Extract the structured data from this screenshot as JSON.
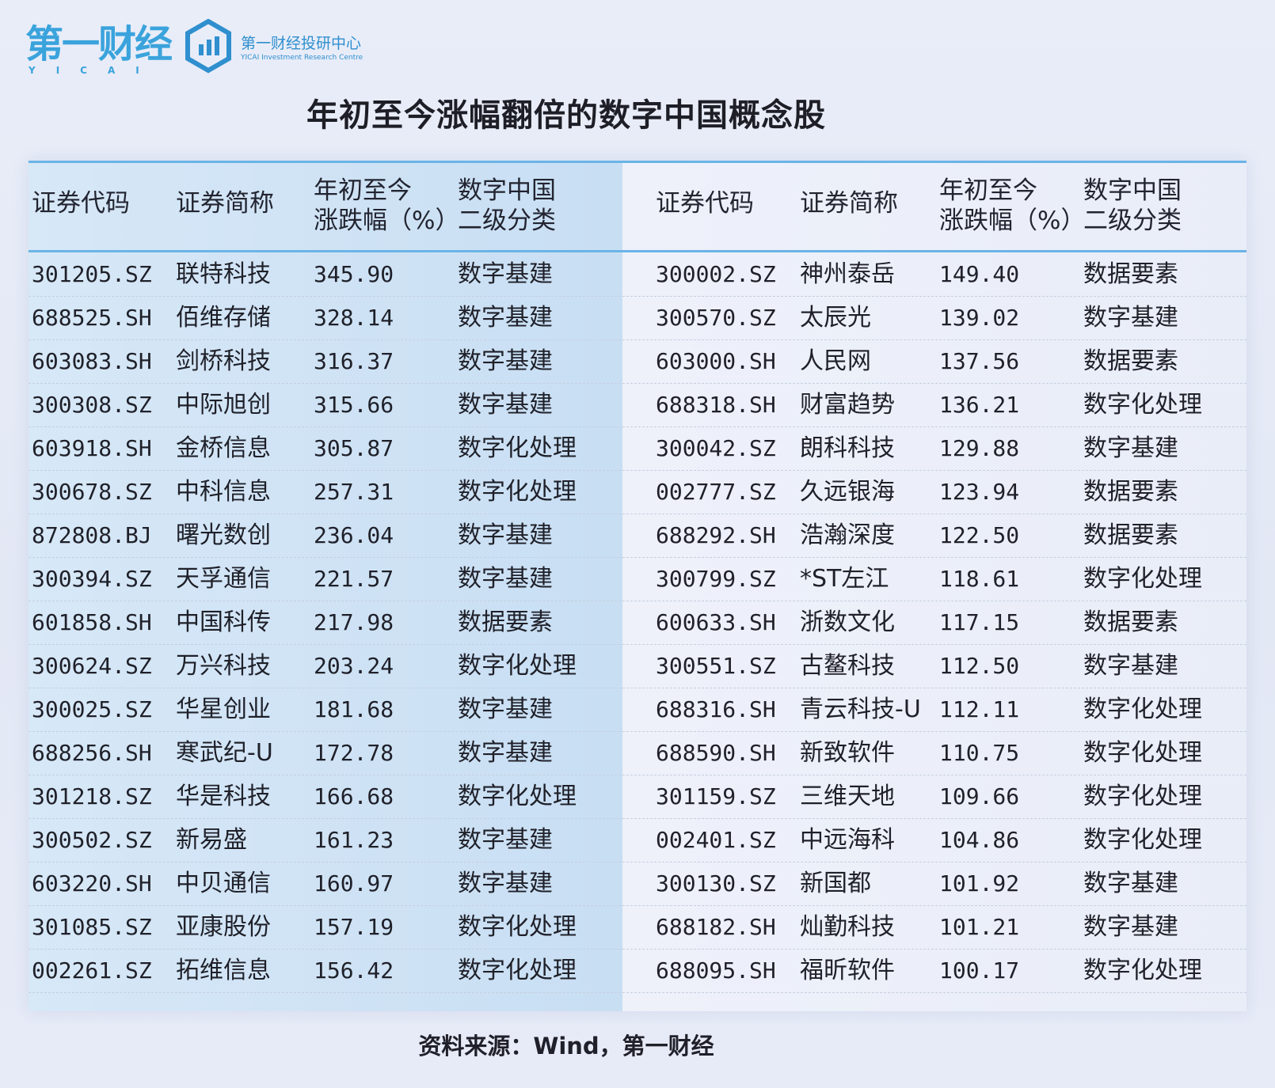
{
  "header": {
    "brand_wordmark": "第一财经",
    "brand_sub": "YICAI",
    "research_cn": "第一财经投研中心",
    "research_en": "YICAI Investment Research Centre",
    "logo_icon": "yicai-research-hexagon-icon",
    "accent_color": "#3aa3dc"
  },
  "title": "年初至今涨幅翻倍的数字中国概念股",
  "table": {
    "headers": {
      "code": "证券代码",
      "name": "证券简称",
      "change_line1": "年初至今",
      "change_line2": "涨跌幅（%）",
      "cat_line1": "数字中国",
      "cat_line2": "二级分类"
    },
    "left_rows": [
      {
        "code": "301205.SZ",
        "name": "联特科技",
        "change": "345.90",
        "category": "数字基建"
      },
      {
        "code": "688525.SH",
        "name": "佰维存储",
        "change": "328.14",
        "category": "数字基建"
      },
      {
        "code": "603083.SH",
        "name": "剑桥科技",
        "change": "316.37",
        "category": "数字基建"
      },
      {
        "code": "300308.SZ",
        "name": "中际旭创",
        "change": "315.66",
        "category": "数字基建"
      },
      {
        "code": "603918.SH",
        "name": "金桥信息",
        "change": "305.87",
        "category": "数字化处理"
      },
      {
        "code": "300678.SZ",
        "name": "中科信息",
        "change": "257.31",
        "category": "数字化处理"
      },
      {
        "code": "872808.BJ",
        "name": "曙光数创",
        "change": "236.04",
        "category": "数字基建"
      },
      {
        "code": "300394.SZ",
        "name": "天孚通信",
        "change": "221.57",
        "category": "数字基建"
      },
      {
        "code": "601858.SH",
        "name": "中国科传",
        "change": "217.98",
        "category": "数据要素"
      },
      {
        "code": "300624.SZ",
        "name": "万兴科技",
        "change": "203.24",
        "category": "数字化处理"
      },
      {
        "code": "300025.SZ",
        "name": "华星创业",
        "change": "181.68",
        "category": "数字基建"
      },
      {
        "code": "688256.SH",
        "name": "寒武纪-U",
        "change": "172.78",
        "category": "数字基建"
      },
      {
        "code": "301218.SZ",
        "name": "华是科技",
        "change": "166.68",
        "category": "数字化处理"
      },
      {
        "code": "300502.SZ",
        "name": "新易盛",
        "change": "161.23",
        "category": "数字基建"
      },
      {
        "code": "603220.SH",
        "name": "中贝通信",
        "change": "160.97",
        "category": "数字基建"
      },
      {
        "code": "301085.SZ",
        "name": "亚康股份",
        "change": "157.19",
        "category": "数字化处理"
      },
      {
        "code": "002261.SZ",
        "name": "拓维信息",
        "change": "156.42",
        "category": "数字化处理"
      }
    ],
    "right_rows": [
      {
        "code": "300002.SZ",
        "name": "神州泰岳",
        "change": "149.40",
        "category": "数据要素"
      },
      {
        "code": "300570.SZ",
        "name": "太辰光",
        "change": "139.02",
        "category": "数字基建"
      },
      {
        "code": "603000.SH",
        "name": "人民网",
        "change": "137.56",
        "category": "数据要素"
      },
      {
        "code": "688318.SH",
        "name": "财富趋势",
        "change": "136.21",
        "category": "数字化处理"
      },
      {
        "code": "300042.SZ",
        "name": "朗科科技",
        "change": "129.88",
        "category": "数字基建"
      },
      {
        "code": "002777.SZ",
        "name": "久远银海",
        "change": "123.94",
        "category": "数据要素"
      },
      {
        "code": "688292.SH",
        "name": "浩瀚深度",
        "change": "122.50",
        "category": "数据要素"
      },
      {
        "code": "300799.SZ",
        "name": "*ST左江",
        "change": "118.61",
        "category": "数字化处理"
      },
      {
        "code": "600633.SH",
        "name": "浙数文化",
        "change": "117.15",
        "category": "数据要素"
      },
      {
        "code": "300551.SZ",
        "name": "古鳌科技",
        "change": "112.50",
        "category": "数字基建"
      },
      {
        "code": "688316.SH",
        "name": "青云科技-U",
        "change": "112.11",
        "category": "数字化处理"
      },
      {
        "code": "688590.SH",
        "name": "新致软件",
        "change": "110.75",
        "category": "数字化处理"
      },
      {
        "code": "301159.SZ",
        "name": "三维天地",
        "change": "109.66",
        "category": "数字化处理"
      },
      {
        "code": "002401.SZ",
        "name": "中远海科",
        "change": "104.86",
        "category": "数字化处理"
      },
      {
        "code": "300130.SZ",
        "name": "新国都",
        "change": "101.92",
        "category": "数字基建"
      },
      {
        "code": "688182.SH",
        "name": "灿勤科技",
        "change": "101.21",
        "category": "数字基建"
      },
      {
        "code": "688095.SH",
        "name": "福昕软件",
        "change": "100.17",
        "category": "数字化处理"
      }
    ]
  },
  "source": "资料来源：Wind，第一财经"
}
